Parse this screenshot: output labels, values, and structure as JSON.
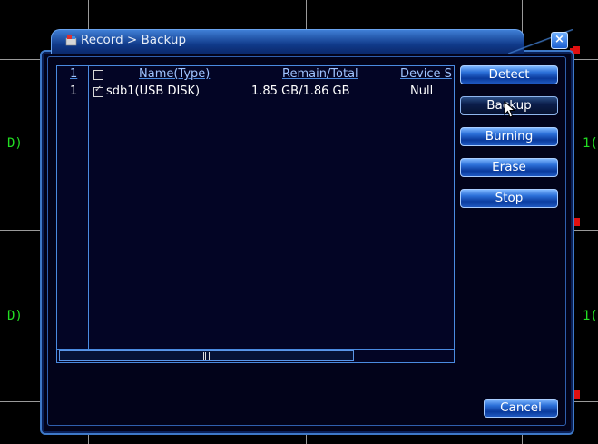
{
  "window": {
    "title": "Record > Backup",
    "close_glyph": "×"
  },
  "background": {
    "channel_labels_left": [
      "D)",
      "D)"
    ],
    "channel_labels_right": [
      "1(",
      "1("
    ]
  },
  "table": {
    "columns": [
      "1",
      "",
      "Name(Type)",
      "Remain/Total",
      "Device S"
    ],
    "rows": [
      {
        "index": "1",
        "checked": true,
        "name": "sdb1(USB DISK)",
        "remain_total": "1.85 GB/1.86 GB",
        "device_status": "Null"
      }
    ]
  },
  "buttons": {
    "detect": "Detect",
    "backup": "Backup",
    "burning": "Burning",
    "erase": "Erase",
    "stop": "Stop",
    "cancel": "Cancel"
  },
  "colors": {
    "accent": "#3e79c8",
    "recording_indicator": "#e01010",
    "channel_label": "#22dd22"
  },
  "icons": [
    "record-backup-icon",
    "close-icon",
    "mouse-cursor-icon",
    "recording-indicator-icon"
  ]
}
